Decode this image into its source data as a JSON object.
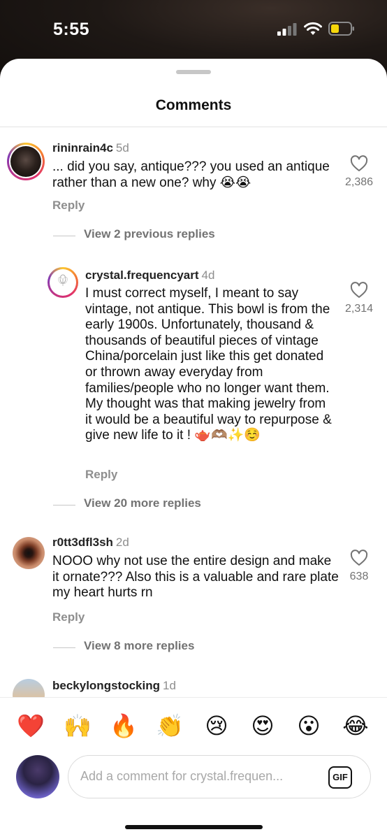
{
  "status_bar": {
    "time": "5:55"
  },
  "sheet": {
    "title": "Comments"
  },
  "comments": [
    {
      "username": "rininrain4c",
      "age": "5d",
      "text": "... did you say, antique??? you used an antique rather than a new one? why 😭😭",
      "likes": "2,386",
      "reply_label": "Reply",
      "view_replies": "View 2 previous replies"
    },
    {
      "username": "crystal.frequencyart",
      "age": "4d",
      "text": "I must correct myself, I meant to say vintage, not antique. This bowl is from the early 1900s. Unfortunately, thousand & thousands of beautiful pieces of vintage China/porcelain just like this get donated or thrown away everyday from families/people who no longer want them. My thought was that making jewelry from it would be a beautiful way to repurpose & give new life to it ! 🫖🫶🏽✨☺️",
      "likes": "2,314",
      "reply_label": "Reply",
      "view_replies": "View 20 more replies",
      "avatar_logo_text": "Crystal Frequency"
    },
    {
      "username": "r0tt3dfl3sh",
      "age": "2d",
      "text": "NOOO why not use the entire design and make it ornate??? Also this is a valuable and rare plate my heart hurts rn",
      "likes": "638",
      "reply_label": "Reply",
      "view_replies": "View 8 more replies"
    },
    {
      "username": "beckylongstocking",
      "age": "1d"
    }
  ],
  "reactions": [
    "❤️",
    "🙌",
    "🔥",
    "👏",
    "😢",
    "😍",
    "😮",
    "😂"
  ],
  "composer": {
    "placeholder": "Add a comment for crystal.frequen...",
    "gif_label": "GIF"
  },
  "colors": {
    "story_ring": "#e1306c",
    "secondary_text": "#8e8e8e"
  }
}
